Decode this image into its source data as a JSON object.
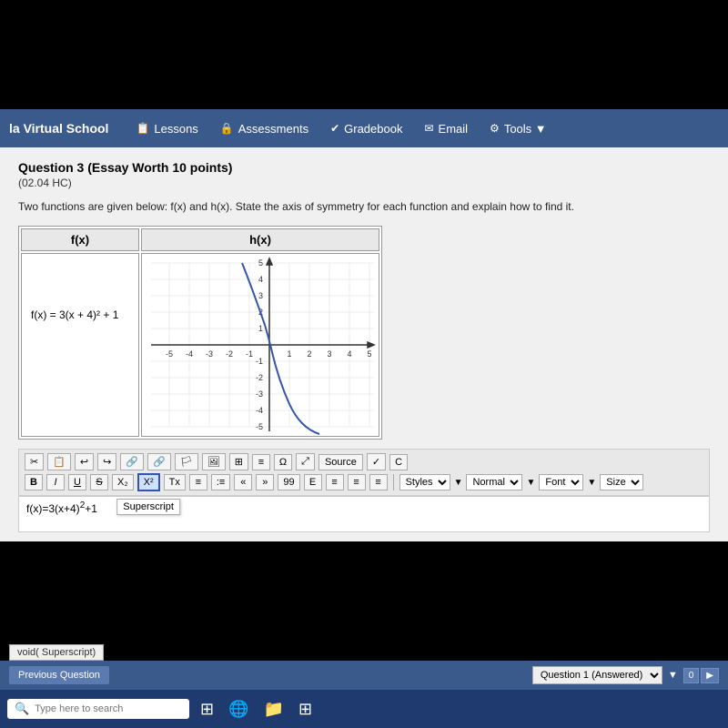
{
  "navbar": {
    "brand": "la Virtual School",
    "links": [
      {
        "label": "Lessons",
        "icon": "📋"
      },
      {
        "label": "Assessments",
        "icon": "🔒"
      },
      {
        "label": "Gradebook",
        "icon": "✔"
      },
      {
        "label": "Email",
        "icon": "✉"
      },
      {
        "label": "Tools ▼",
        "icon": "⚙"
      }
    ]
  },
  "question": {
    "title": "Question 3",
    "title_suffix": " (Essay Worth 10 points)",
    "subtitle": "(02.04 HC)",
    "body": "Two functions are given below: f(x) and h(x). State the axis of symmetry for each function and explain how to find it.",
    "table": {
      "col1_header": "f(x)",
      "col2_header": "h(x)",
      "fx_formula": "f(x) = 3(x + 4)² + 1"
    }
  },
  "toolbar": {
    "row1_buttons": [
      "✂",
      "📋",
      "↩",
      "↪",
      "🔗",
      "🔗",
      "🏳",
      "🖼",
      "⊞",
      "≡",
      "Ω",
      "⤢",
      "Source",
      "✓",
      "C"
    ],
    "source_label": "Source",
    "row2_buttons": [
      "B",
      "I",
      "U",
      "S",
      "X₂",
      "X²",
      "Tx",
      "≡",
      ":≡",
      "«",
      "»",
      "99",
      "E",
      "≡",
      "≡",
      "≡"
    ],
    "styles_label": "Styles",
    "normal_label": "Normal",
    "font_label": "Font",
    "size_label": "Size",
    "superscript_tooltip": "Superscript"
  },
  "answer": {
    "text": "f(x)=3(x+4)²+1"
  },
  "bottom_bar": {
    "prev_button": "Previous Question",
    "question_selector": "Question 1 (Answered)",
    "nav_icons": [
      "0",
      "▶"
    ]
  },
  "taskbar": {
    "search_placeholder": "Type here to search",
    "search_icon": "🔍"
  },
  "status_tooltip": "void( Superscript)"
}
